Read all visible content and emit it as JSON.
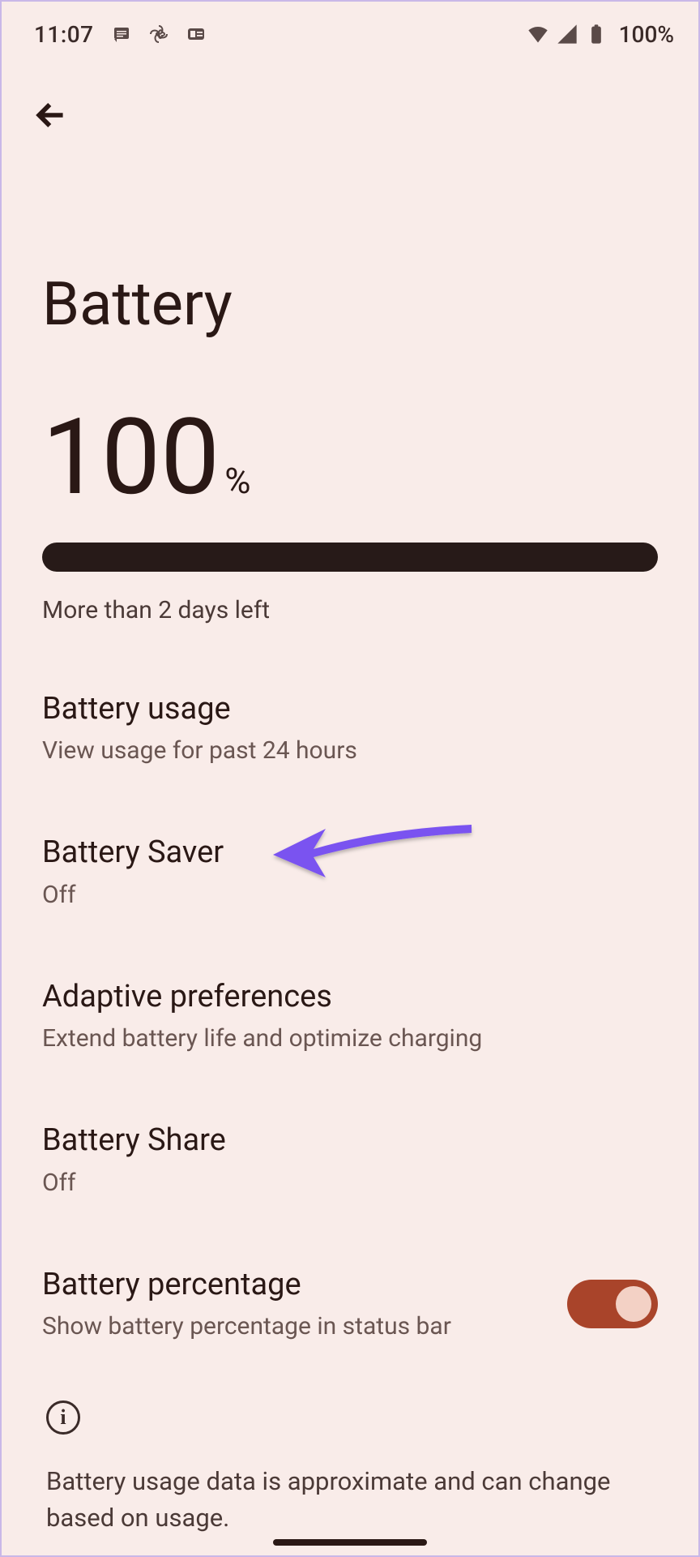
{
  "statusbar": {
    "time": "11:07",
    "battery_pct": "100%"
  },
  "page": {
    "title": "Battery"
  },
  "level": {
    "number": "100",
    "symbol": "%",
    "estimate": "More than 2 days left",
    "fill_pct": 100
  },
  "settings": [
    {
      "title": "Battery usage",
      "sub": "View usage for past 24 hours"
    },
    {
      "title": "Battery Saver",
      "sub": "Off"
    },
    {
      "title": "Adaptive preferences",
      "sub": "Extend battery life and optimize charging"
    },
    {
      "title": "Battery Share",
      "sub": "Off"
    },
    {
      "title": "Battery percentage",
      "sub": "Show battery percentage in status bar",
      "toggle": true
    }
  ],
  "info": {
    "text": "Battery usage data is approximate and can change based on usage."
  }
}
